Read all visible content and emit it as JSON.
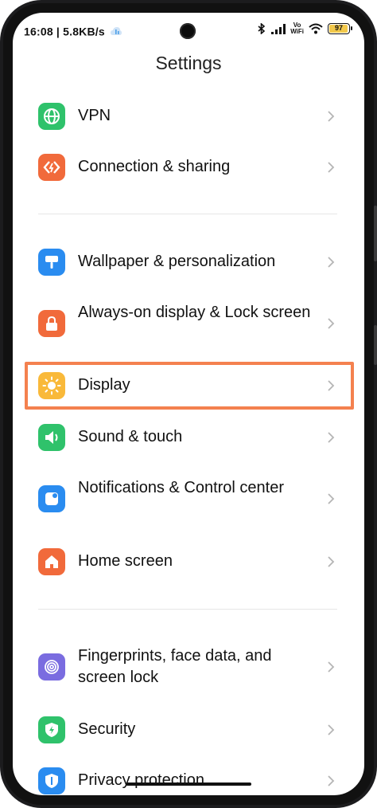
{
  "status": {
    "time": "16:08",
    "speed": "5.8KB/s",
    "vowifi_top": "Vo",
    "vowifi_bottom": "WiFi",
    "battery": "97",
    "battery_level": 0.97,
    "battery_color": "#f2c84b"
  },
  "header": {
    "title": "Settings"
  },
  "colors": {
    "highlight": "#f4814f",
    "chevron": "#b5b5b5"
  },
  "groups": [
    {
      "items": [
        {
          "label": "VPN",
          "icon": "globe-icon",
          "color": "#2fc26b"
        },
        {
          "label": "Connection & sharing",
          "icon": "share-icon",
          "color": "#f16a3b"
        }
      ]
    },
    {
      "items": [
        {
          "label": "Wallpaper & personalization",
          "icon": "paint-roller-icon",
          "color": "#2a8cf0"
        },
        {
          "label": "Always-on display & Lock screen",
          "icon": "lock-icon",
          "color": "#f16a3b"
        },
        {
          "label": "Display",
          "icon": "sun-icon",
          "color": "#f9b93a",
          "highlighted": true
        },
        {
          "label": "Sound & touch",
          "icon": "speaker-icon",
          "color": "#2fc26b"
        },
        {
          "label": "Notifications & Control center",
          "icon": "notification-icon",
          "color": "#2a8cf0"
        },
        {
          "label": "Home screen",
          "icon": "home-icon",
          "color": "#f16a3b"
        }
      ]
    },
    {
      "items": [
        {
          "label": "Fingerprints, face data, and screen lock",
          "icon": "fingerprint-icon",
          "color": "#7a6ce0"
        },
        {
          "label": "Security",
          "icon": "shield-icon",
          "color": "#2fc26b"
        },
        {
          "label": "Privacy protection",
          "icon": "privacy-icon",
          "color": "#2a8cf0"
        }
      ]
    }
  ]
}
